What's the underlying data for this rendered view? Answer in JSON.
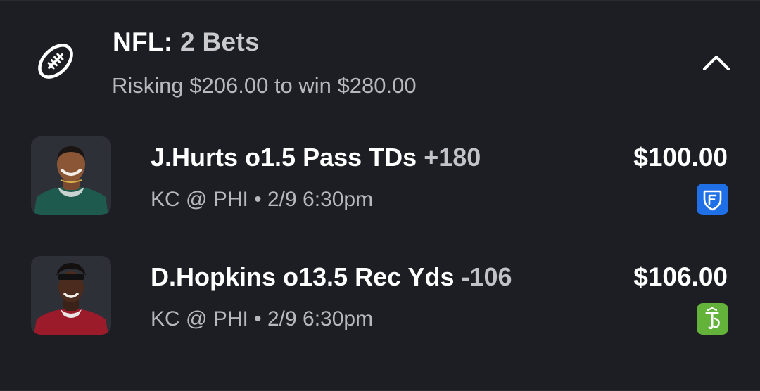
{
  "header": {
    "league": "NFL:",
    "bet_count": "2 Bets",
    "summary": "Risking $206.00 to win $280.00",
    "league_icon": "football-icon",
    "collapse_icon": "chevron-up-icon"
  },
  "bets": [
    {
      "player_avatar": "player-photo",
      "pick": "J.Hurts o1.5 Pass TDs",
      "odds": "+180",
      "game": "KC @ PHI • 2/9 6:30pm",
      "stake": "$100.00",
      "sportsbook_icon": "fanduel-logo-icon",
      "sportsbook_color": "#1f6fe6"
    },
    {
      "player_avatar": "player-photo",
      "pick": "D.Hopkins o13.5 Rec Yds",
      "odds": "-106",
      "game": "KC @ PHI • 2/9 6:30pm",
      "stake": "$106.00",
      "sportsbook_icon": "draftkings-logo-icon",
      "sportsbook_color": "#63b33a"
    }
  ],
  "colors": {
    "background": "#1d1e24",
    "text_primary": "#ffffff",
    "text_secondary": "#b7b7bd"
  }
}
